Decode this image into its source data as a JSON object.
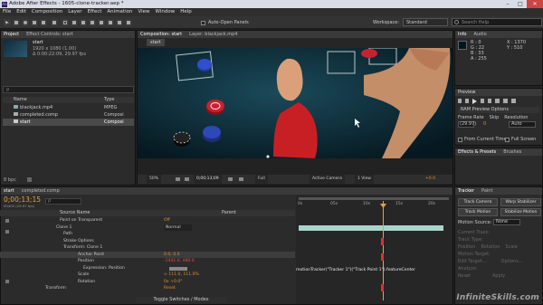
{
  "window": {
    "title": "Adobe After Effects - 1605-clone-tracker.aep *",
    "app_icon": "Ae"
  },
  "menu": [
    "File",
    "Edit",
    "Composition",
    "Layer",
    "Effect",
    "Animation",
    "View",
    "Window",
    "Help"
  ],
  "toolbar": {
    "auto_open_label": "Auto-Open Panels",
    "workspace_label": "Workspace:",
    "workspace_value": "Standard",
    "search_placeholder": "Search Help"
  },
  "project": {
    "tabs": [
      "Project",
      "Effect Controls: start"
    ],
    "comp_name": "start",
    "comp_info": [
      "1920 x 1080 (1.00)",
      "Δ 0:00:22:09, 29.97 fps"
    ],
    "search_placeholder": "ρ",
    "col_name": "Name",
    "col_type": "Type",
    "items": [
      {
        "name": "blackjack.mp4",
        "type": "MPEG"
      },
      {
        "name": "completed.comp",
        "type": "Composi"
      },
      {
        "name": "start",
        "type": "Composi"
      }
    ],
    "footer": "8 bpc"
  },
  "viewer_tabs": [
    "Composition: start",
    "Layer: blackjack.mp4"
  ],
  "viewer_breadcrumb": "start",
  "viewer_controls": {
    "zoom": "50%",
    "timecode": "0;00;13;09",
    "resolution": "Full",
    "camera": "Active Camera",
    "views": "1 View",
    "exposure": "+0.0"
  },
  "info": {
    "tabs": [
      "Info",
      "Audio"
    ],
    "r": "R : 0",
    "g": "G : 22",
    "b": "B : 33",
    "a": "A : 255",
    "x": "X : 1370",
    "y": "Y : 510"
  },
  "preview": {
    "title": "Preview",
    "ram_options": "RAM Preview Options",
    "frame_rate_label": "Frame Rate",
    "skip_label": "Skip",
    "resolution_label": "Resolution",
    "frame_rate": "(29.97)",
    "skip": "0",
    "resolution": "Auto",
    "from_current": "From Current Time",
    "full_screen": "Full Screen"
  },
  "effects_tabs": [
    "Effects & Presets",
    "Brushes"
  ],
  "tracker": {
    "tabs": [
      "Tracker",
      "Paint"
    ],
    "track_camera": "Track Camera",
    "warp_stabilizer": "Warp Stabilizer",
    "track_motion": "Track Motion",
    "stabilize_motion": "Stabilize Motion",
    "motion_source_label": "Motion Source:",
    "motion_source": "None",
    "rows": [
      "Current Track:",
      "Track Type:",
      "Position",
      "Rotation",
      "Scale",
      "Motion Target:",
      "Edit Target...",
      "Options...",
      "Analyze:",
      "Reset",
      "Apply"
    ]
  },
  "timeline": {
    "tabs": [
      "start",
      "completed.comp"
    ],
    "timecode": "0;00;13;15",
    "frame_info": "00405 (29.97 fps)",
    "search_placeholder": "ρ",
    "col_source": "Source Name",
    "col_parent": "Parent",
    "ruler": [
      "0s",
      "05s",
      "10s",
      "15s",
      "20s"
    ],
    "rows": [
      {
        "indent": 0,
        "label": "Paint on Transparent",
        "value": "Off"
      },
      {
        "indent": 0,
        "label": "Clone 1",
        "value": "Normal"
      },
      {
        "indent": 1,
        "label": "Path",
        "value": ""
      },
      {
        "indent": 1,
        "label": "Stroke Options",
        "value": ""
      },
      {
        "indent": 1,
        "label": "Transform: Clone 1",
        "value": ""
      },
      {
        "indent": 2,
        "label": "Anchor Point",
        "value": "0.0, 0.0"
      },
      {
        "indent": 2,
        "label": "Position",
        "value": "-1441.6, 480.6"
      },
      {
        "indent": 3,
        "label": "Expression: Position",
        "value": ""
      },
      {
        "indent": 2,
        "label": "Scale",
        "value": "∞ 111.0, 111.0%"
      },
      {
        "indent": 2,
        "label": "Rotation",
        "value": "0x +0.0°"
      },
      {
        "indent": 0,
        "label": "Transform",
        "value": "Reset"
      }
    ],
    "expression": "motionTracker(\"Tracker 1\")(\"Track Point 1\").featureCenter",
    "footer_label": "Toggle Switches / Modes"
  },
  "watermark": "InfiniteSkills.com",
  "colors": {
    "timeline_bar": "#a8d4cc",
    "cti": "#e8a040",
    "keyframe": "#e03030",
    "chip_red": "#b8202a",
    "sleeve": "#c81f25",
    "felt": "#0d2d3a"
  }
}
